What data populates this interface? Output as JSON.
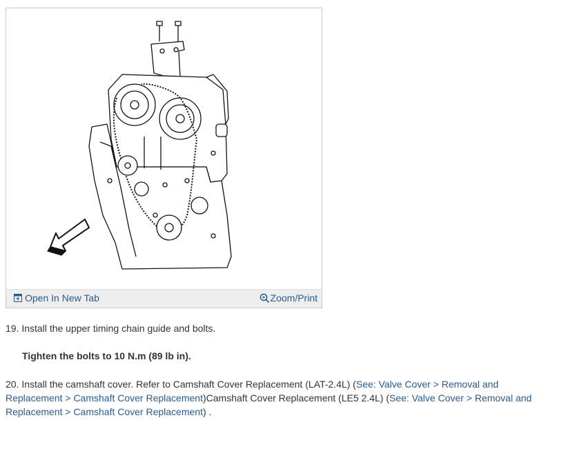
{
  "figure": {
    "open_tab_label": "Open In New Tab",
    "zoom_label": "Zoom/Print",
    "icons": {
      "open_tab": "open-tab-icon",
      "zoom": "zoom-in-icon"
    },
    "accent_color": "#2a5a8c"
  },
  "steps": {
    "step19": "19. Install the upper timing chain guide and bolts.",
    "note": "Tighten the bolts to 10 N.m (89 lb in).",
    "step20": {
      "prefix": "20. Install the camshaft cover. Refer to Camshaft Cover Replacement (LAT-2.4L) (",
      "link1": "See: Valve Cover > Removal and Replacement > Camshaft Cover Replacement",
      "middle": ")Camshaft Cover Replacement (LE5 2.4L) (",
      "link2": "See: Valve Cover > Removal and Replacement > Camshaft Cover Replacement",
      "suffix": ") ."
    }
  }
}
